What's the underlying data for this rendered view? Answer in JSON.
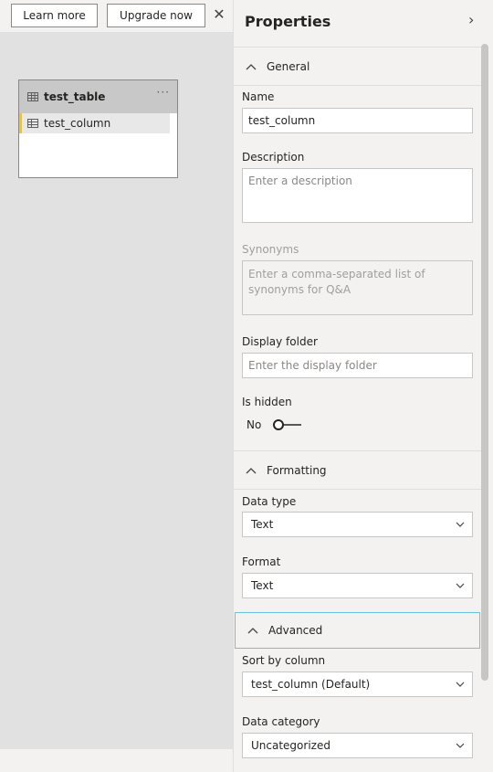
{
  "toolbar": {
    "learn_more": "Learn more",
    "upgrade_now": "Upgrade now",
    "close_icon": "close-icon"
  },
  "canvas": {
    "table_name": "test_table",
    "more_icon": "ellipsis-icon",
    "columns": [
      {
        "name": "test_column"
      }
    ]
  },
  "properties": {
    "title": "Properties",
    "collapse_icon": "chevron-right-icon",
    "sections": {
      "general": "General",
      "formatting": "Formatting",
      "advanced": "Advanced"
    },
    "name": {
      "label": "Name",
      "value": "test_column"
    },
    "description": {
      "label": "Description",
      "placeholder": "Enter a description"
    },
    "synonyms": {
      "label": "Synonyms",
      "placeholder": "Enter a comma-separated list of synonyms for Q&A"
    },
    "display_folder": {
      "label": "Display folder",
      "placeholder": "Enter the display folder"
    },
    "is_hidden": {
      "label": "Is hidden",
      "state": "No"
    },
    "data_type": {
      "label": "Data type",
      "value": "Text"
    },
    "format": {
      "label": "Format",
      "value": "Text"
    },
    "sort_by_column": {
      "label": "Sort by column",
      "value": "test_column (Default)"
    },
    "data_category": {
      "label": "Data category",
      "value": "Uncategorized"
    }
  },
  "colors": {
    "accent_yellow": "#f2c811",
    "focus_border": "#6bc1e0",
    "pane_bg": "#f3f2f1",
    "canvas_bg": "#e1e1e1"
  }
}
